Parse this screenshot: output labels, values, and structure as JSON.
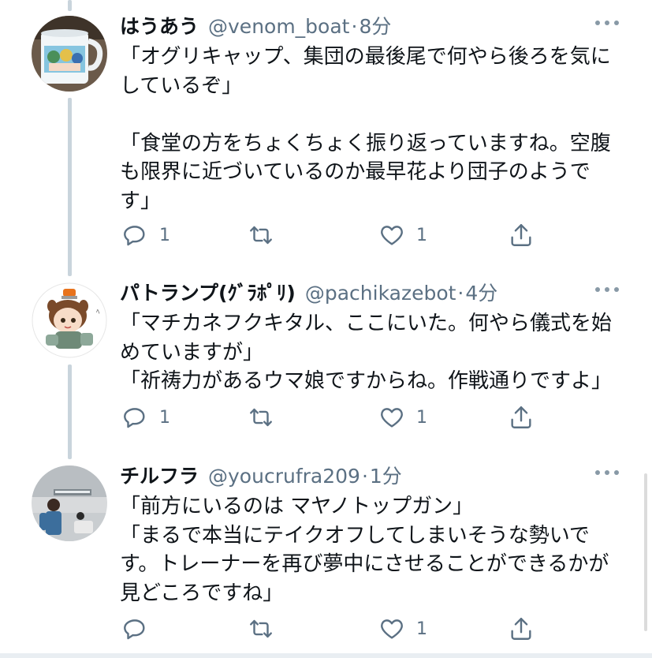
{
  "tweets": [
    {
      "name": "はうあう",
      "handle": "@venom_boat",
      "dot": "·",
      "time": "8分",
      "text": "「オグリキャップ、集団の最後尾で何やら後ろを気に\nしているぞ」\n\n「食堂の方をちょくちょく振り返っていますね。空腹\nも限界に近づいているのか最早花より団子のようで\nす」",
      "reply_count": "1",
      "retweet_count": "",
      "like_count": "1"
    },
    {
      "name": "パトランプ(ｸﾞﾗﾎﾟﾘ)",
      "handle": "@pachikazebot",
      "dot": "·",
      "time": "4分",
      "text": "「マチカネフクキタル、ここにいた。何やら儀式を始\nめていますが」\n「祈祷力があるウマ娘ですからね。作戦通りですよ」",
      "reply_count": "1",
      "retweet_count": "",
      "like_count": "1"
    },
    {
      "name": "チルフラ",
      "handle": "@youcrufra209",
      "dot": "·",
      "time": "1分",
      "text": "「前方にいるのは マヤノトップガン」\n「まるで本当にテイクオフしてしまいそうな勢いで\nす。トレーナーを再び夢中にさせることができるかが\n見どころですね」",
      "reply_count": "",
      "retweet_count": "",
      "like_count": "1"
    }
  ],
  "icons": {
    "reply": "reply-icon",
    "retweet": "retweet-icon",
    "like": "heart-icon",
    "share": "share-icon",
    "more": "more-icon"
  },
  "colors": {
    "text": "#0f1419",
    "secondary": "#5b7083",
    "thread_line": "#c9d4dc"
  }
}
